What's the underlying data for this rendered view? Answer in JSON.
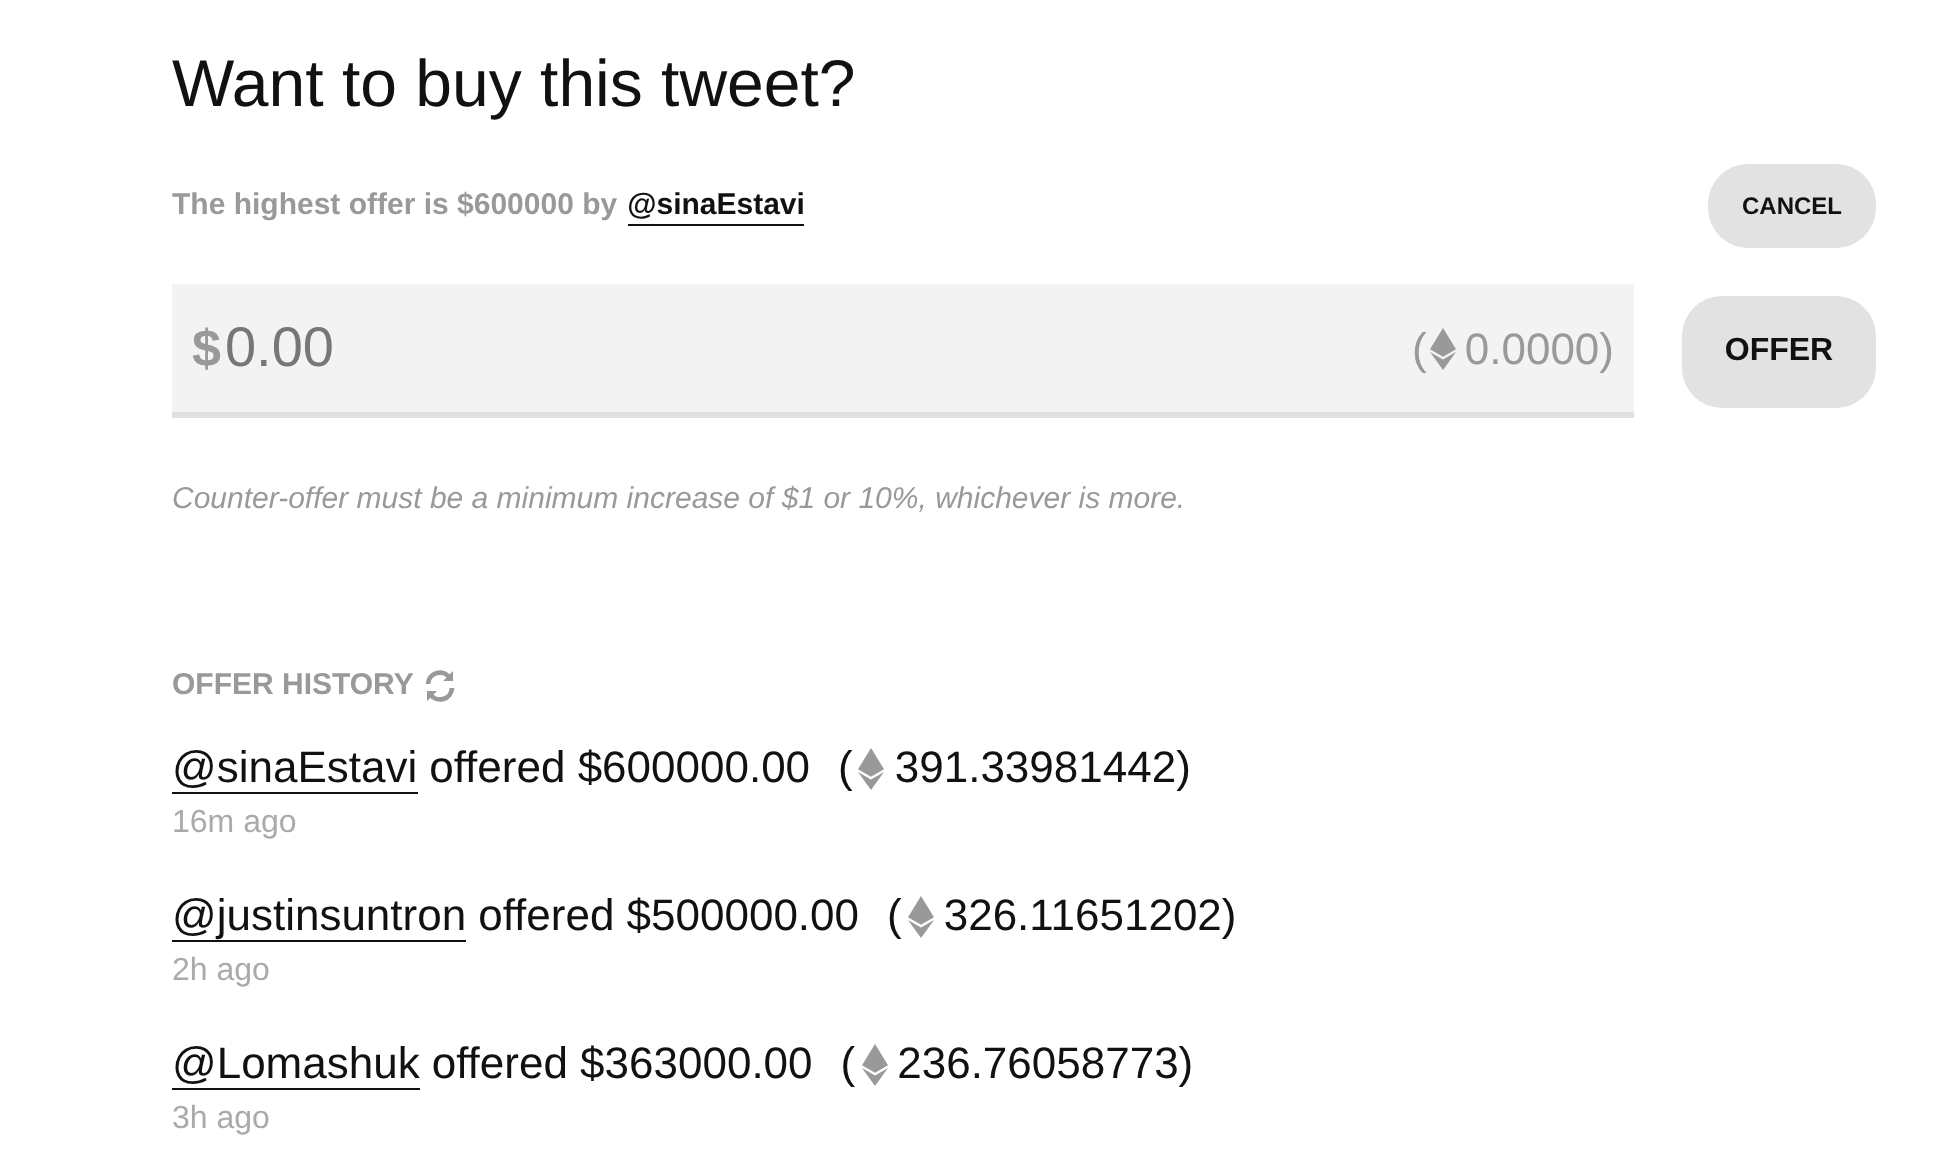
{
  "title": "Want to buy this tweet?",
  "highest_offer": {
    "text": "The highest offer is $600000 by",
    "handle": "@sinaEstavi"
  },
  "cancel_button": "CANCEL",
  "offer_input": {
    "currency": "$",
    "placeholder": "0.00",
    "eth_open": "(",
    "eth_value": "0.0000)"
  },
  "offer_button": "OFFER",
  "hint": "Counter-offer must be a minimum increase of $1 or 10%, whichever is more.",
  "history": {
    "heading": "OFFER HISTORY",
    "entries": [
      {
        "handle": "@sinaEstavi",
        "text": "offered $600000.00",
        "eth_open": "(",
        "eth_value": "391.33981442)",
        "time": "16m ago"
      },
      {
        "handle": "@justinsuntron",
        "text": "offered $500000.00",
        "eth_open": "(",
        "eth_value": "326.11651202)",
        "time": "2h ago"
      },
      {
        "handle": "@Lomashuk",
        "text": "offered $363000.00",
        "eth_open": "(",
        "eth_value": "236.76058773)",
        "time": "3h ago"
      }
    ]
  }
}
